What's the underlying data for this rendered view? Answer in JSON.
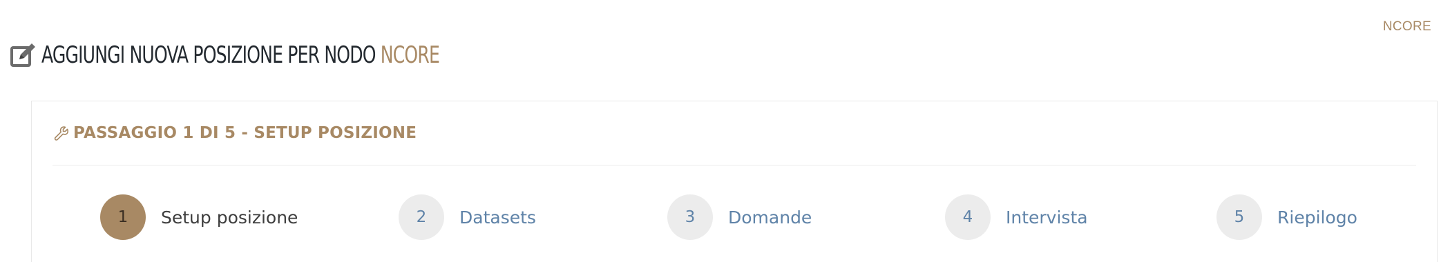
{
  "header": {
    "top_right_label": "NCORE",
    "title_prefix": "AGGIUNGI NUOVA POSIZIONE PER NODO",
    "node_name": "NCORE",
    "title_icon": "edit-icon"
  },
  "card": {
    "title": "PASSAGGIO 1 DI 5 - SETUP POSIZIONE",
    "title_icon": "wrench-icon"
  },
  "steps": [
    {
      "number": "1",
      "label": "Setup posizione",
      "active": true
    },
    {
      "number": "2",
      "label": "Datasets",
      "active": false
    },
    {
      "number": "3",
      "label": "Domande",
      "active": false
    },
    {
      "number": "4",
      "label": "Intervista",
      "active": false
    },
    {
      "number": "5",
      "label": "Riepilogo",
      "active": false
    }
  ],
  "colors": {
    "accent": "#a88964",
    "link": "#5f83a8",
    "title": "#23292f",
    "step_bg": "#ececec"
  }
}
